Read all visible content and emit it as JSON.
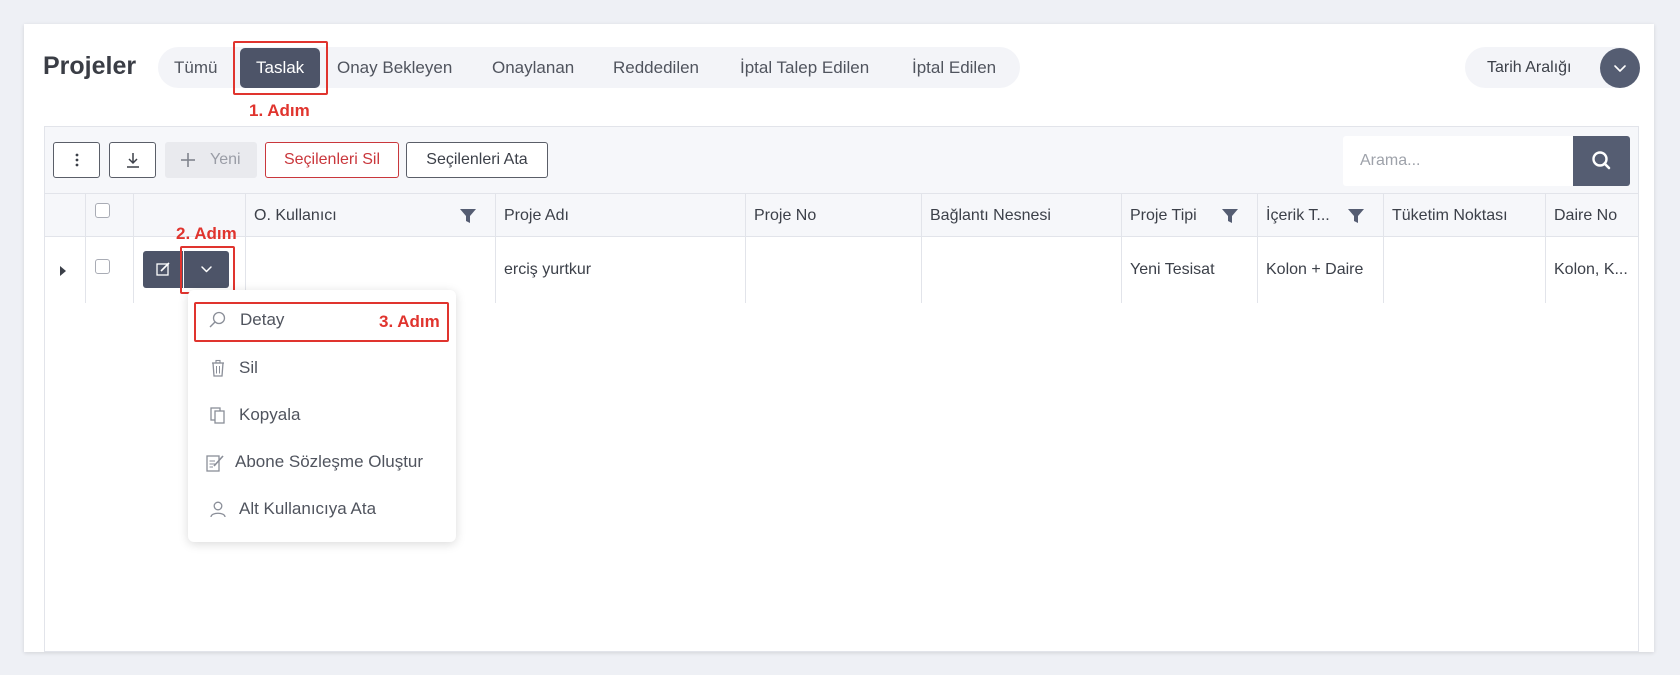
{
  "page": {
    "title": "Projeler"
  },
  "tabs": [
    {
      "label": "Tümü",
      "active": false
    },
    {
      "label": "Taslak",
      "active": true
    },
    {
      "label": "Onay Bekleyen",
      "active": false
    },
    {
      "label": "Onaylanan",
      "active": false
    },
    {
      "label": "Reddedilen",
      "active": false
    },
    {
      "label": "İptal Talep Edilen",
      "active": false
    },
    {
      "label": "İptal Edilen",
      "active": false
    }
  ],
  "date_range": {
    "label": "Tarih Aralığı",
    "icon": "chevron-down-icon"
  },
  "annotations": {
    "step1": "1. Adım",
    "step2": "2. Adım",
    "step3": "3. Adım",
    "color": "#e0342e"
  },
  "toolbar": {
    "more_icon": "more-vertical-icon",
    "download_icon": "download-icon",
    "new_label": "Yeni",
    "new_icon": "plus-icon",
    "delete_selected_label": "Seçilenleri Sil",
    "assign_selected_label": "Seçilenleri Ata"
  },
  "search": {
    "placeholder": "Arama...",
    "icon": "search-icon"
  },
  "table": {
    "columns": [
      {
        "label": "",
        "filter": false
      },
      {
        "label": "",
        "filter": false
      },
      {
        "label": "",
        "filter": false
      },
      {
        "label": "O. Kullanıcı",
        "filter": true
      },
      {
        "label": "Proje Adı",
        "filter": false
      },
      {
        "label": "Proje No",
        "filter": false
      },
      {
        "label": "Bağlantı Nesnesi",
        "filter": false
      },
      {
        "label": "Proje Tipi",
        "filter": true
      },
      {
        "label": "İçerik T...",
        "filter": true
      },
      {
        "label": "Tüketim Noktası",
        "filter": false
      },
      {
        "label": "Daire No",
        "filter": false
      }
    ],
    "rows": [
      {
        "o_kullanici": "",
        "proje_adi": "erciş yurtkur",
        "proje_no": "",
        "baglanti_nesnesi": "",
        "proje_tipi": "Yeni Tesisat",
        "icerik_tipi": "Kolon + Daire",
        "tuketim_noktasi": "",
        "daire_no": "Kolon, K..."
      }
    ]
  },
  "action_menu": {
    "items": [
      {
        "label": "Detay",
        "icon": "search-icon"
      },
      {
        "label": "Sil",
        "icon": "trash-icon"
      },
      {
        "label": "Kopyala",
        "icon": "copy-icon"
      },
      {
        "label": "Abone Sözleşme Oluştur",
        "icon": "edit-document-icon"
      },
      {
        "label": "Alt Kullanıcıya Ata",
        "icon": "user-icon"
      }
    ]
  },
  "colors": {
    "primary": "#4d5468",
    "danger": "#c9373c",
    "background": "#eef0f5"
  }
}
